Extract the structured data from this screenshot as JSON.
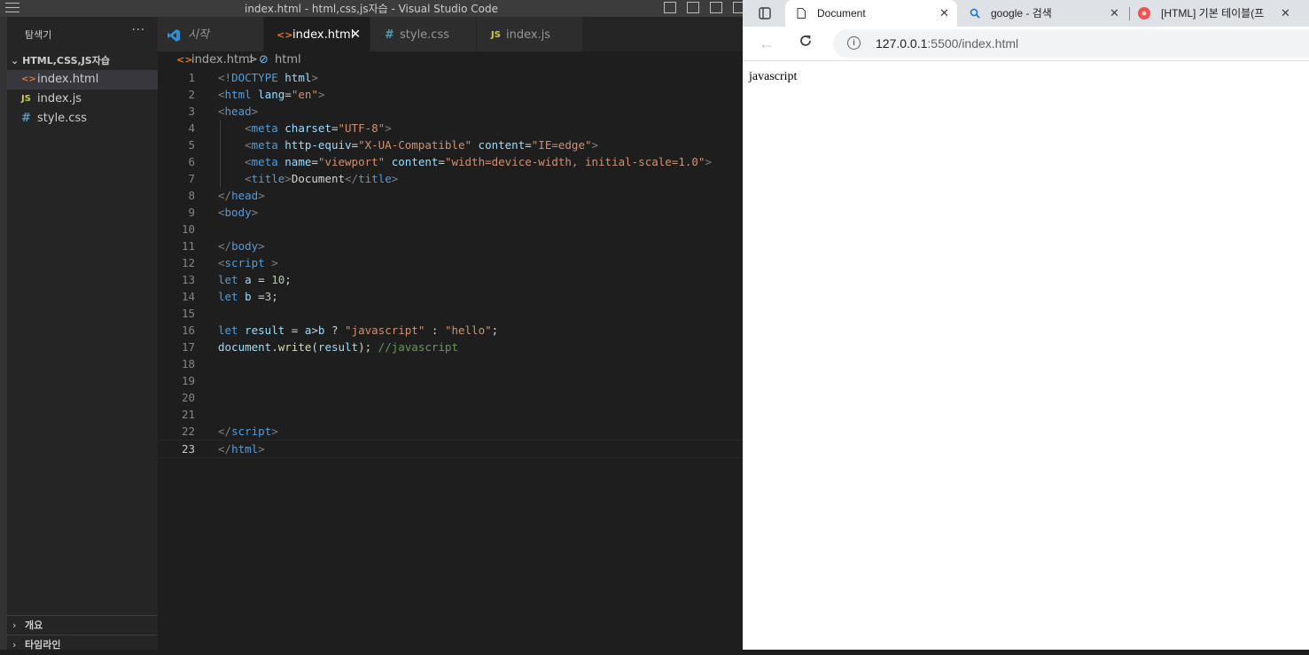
{
  "vscode": {
    "window_title": "index.html - html,css,js자습 - Visual Studio Code",
    "explorer_title": "탐색기",
    "more_actions": "···",
    "folder_name": "HTML,CSS,JS자습",
    "files": [
      {
        "icon": "<>",
        "name": "index.html",
        "icon_color": "#e37933",
        "active": true
      },
      {
        "icon": "JS",
        "name": "index.js",
        "icon_color": "#cbcb41",
        "active": false
      },
      {
        "icon": "#",
        "name": "style.css",
        "icon_color": "#519aba",
        "active": false
      }
    ],
    "bottom_panels": [
      "개요",
      "타임라인"
    ],
    "tabs": [
      {
        "icon": "vscode",
        "label": "시작"
      },
      {
        "icon": "<>",
        "label": "index.html",
        "close": "✕"
      },
      {
        "icon": "#",
        "label": "style.css"
      },
      {
        "icon": "JS",
        "label": "index.js"
      }
    ],
    "breadcrumb": {
      "file": "index.html",
      "separator": ">",
      "symbol": "html"
    },
    "current_line": 23
  },
  "browser": {
    "tabs": [
      {
        "label": "Document",
        "active": true,
        "close": "✕"
      },
      {
        "label": "google - 검색",
        "close": "✕"
      },
      {
        "label": "[HTML] 기본 테이블(프",
        "close": "✕"
      }
    ],
    "url_host": "127.0.0.1",
    "url_rest": ":5500/index.html",
    "page_text": "javascript"
  },
  "colors": {
    "vscode_accent": "#007acc",
    "html_icon": "#e37933",
    "js_icon": "#cbcb41",
    "css_icon": "#519aba"
  }
}
